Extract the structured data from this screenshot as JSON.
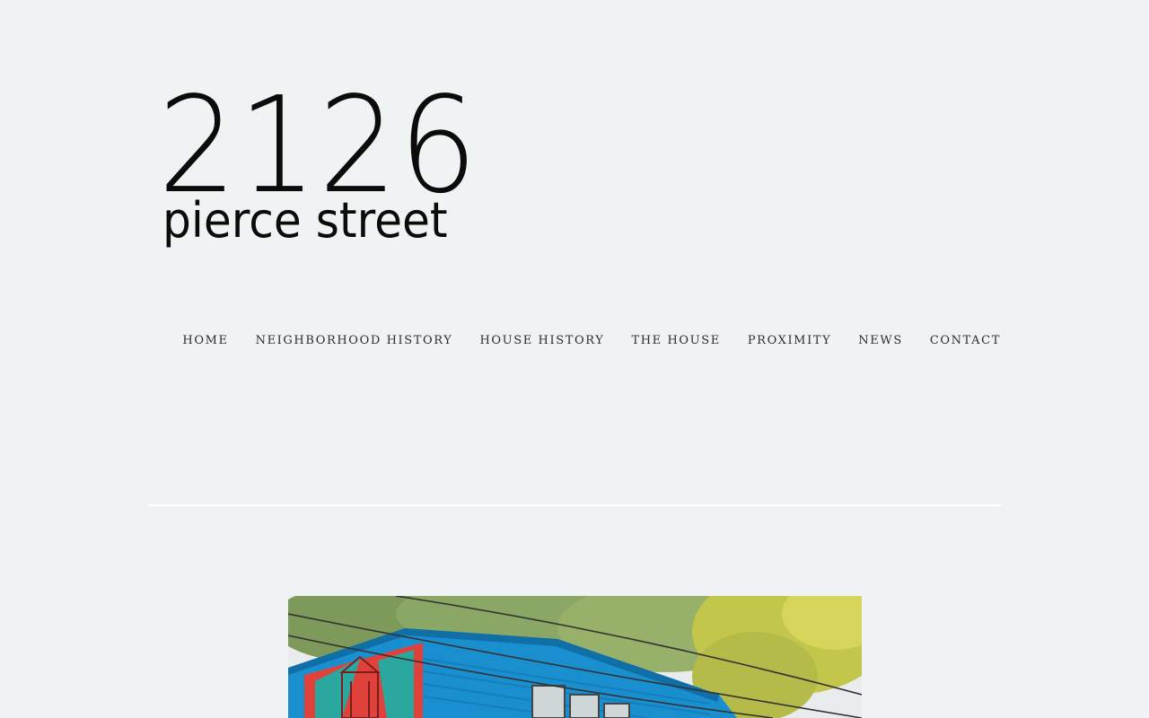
{
  "logo": {
    "number": "2126",
    "subtitle": "pierce street"
  },
  "nav": {
    "items": [
      {
        "label": "HOME"
      },
      {
        "label": "NEIGHBORHOOD HISTORY"
      },
      {
        "label": "HOUSE HISTORY"
      },
      {
        "label": "THE HOUSE"
      },
      {
        "label": "PROXIMITY"
      },
      {
        "label": "NEWS"
      },
      {
        "label": "CONTACT"
      }
    ]
  },
  "colors": {
    "background": "#f0f3f4",
    "divider": "#ffffff",
    "nav_text": "#2c2c2c",
    "house_siding": "#1a8fd0",
    "mural_red": "#e0413a",
    "foliage": "#c9c944"
  }
}
